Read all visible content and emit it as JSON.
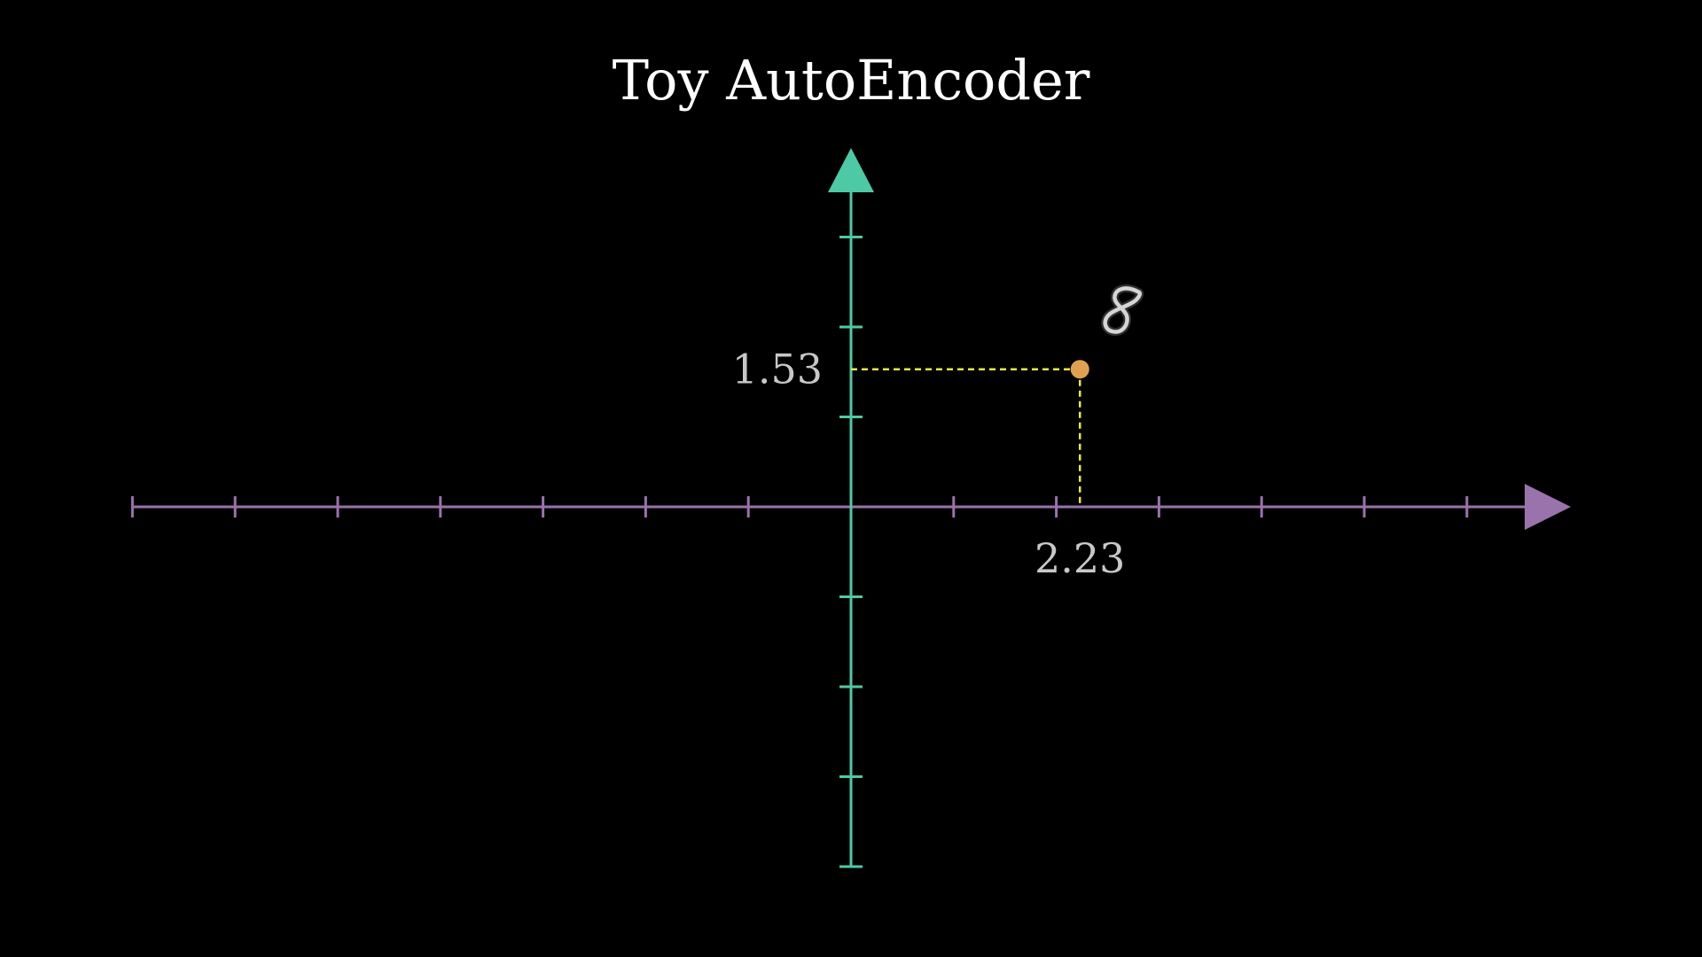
{
  "title": "Toy AutoEncoder",
  "colors": {
    "background": "#000000",
    "x_axis": "#9a72ac",
    "y_axis": "#4ec9a6",
    "guide_lines": "#e8e84a",
    "point": "#e0a050",
    "text": "#c8c8c8",
    "title": "#ffffff"
  },
  "chart_data": {
    "type": "scatter",
    "xlim": [
      -7,
      7
    ],
    "ylim": [
      -4,
      4
    ],
    "x_ticks": [
      -7,
      -6,
      -5,
      -4,
      -3,
      -2,
      -1,
      1,
      2,
      3,
      4,
      5,
      6
    ],
    "y_ticks": [
      -4,
      -3,
      -2,
      -1,
      1,
      2,
      3
    ],
    "point": {
      "x": 2.23,
      "y": 1.53,
      "x_label": "2.23",
      "y_label": "1.53"
    },
    "point_image": "handwritten-digit-8"
  }
}
